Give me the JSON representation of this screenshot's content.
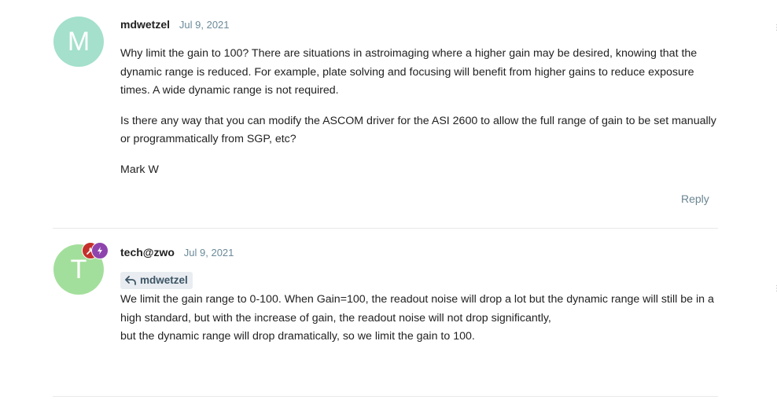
{
  "posts": [
    {
      "avatar_letter": "M",
      "avatar_color": "#a4e0cb",
      "username": "mdwetzel",
      "date": "Jul 9, 2021",
      "paragraphs": [
        "Why limit the gain to 100? There are situations in astroimaging where a higher gain may be desired, knowing that the dynamic range is reduced. For example, plate solving and focusing will benefit from higher gains to reduce exposure times. A wide dynamic range is not required.",
        "Is there any way that you can modify the ASCOM driver for the ASI 2600 to allow the full range of gain to be set manually or programmatically from SGP, etc?",
        "Mark W"
      ],
      "reply_label": "Reply"
    },
    {
      "avatar_letter": "T",
      "avatar_color": "#a3df9c",
      "username": "tech@zwo",
      "date": "Jul 9, 2021",
      "reply_to": "mdwetzel",
      "lines": [
        "We limit the gain range to 0-100. When Gain=100, the readout noise will drop a lot but the dynamic range will still be in a high standard, but with the increase of gain, the readout noise will not drop significantly,",
        "but the dynamic range will drop dramatically, so we limit the gain to 100."
      ],
      "flair_colors": [
        "#c4302b",
        "#8e44ad"
      ],
      "flair_icons": [
        "wrench-icon",
        "lightning-icon"
      ]
    }
  ]
}
